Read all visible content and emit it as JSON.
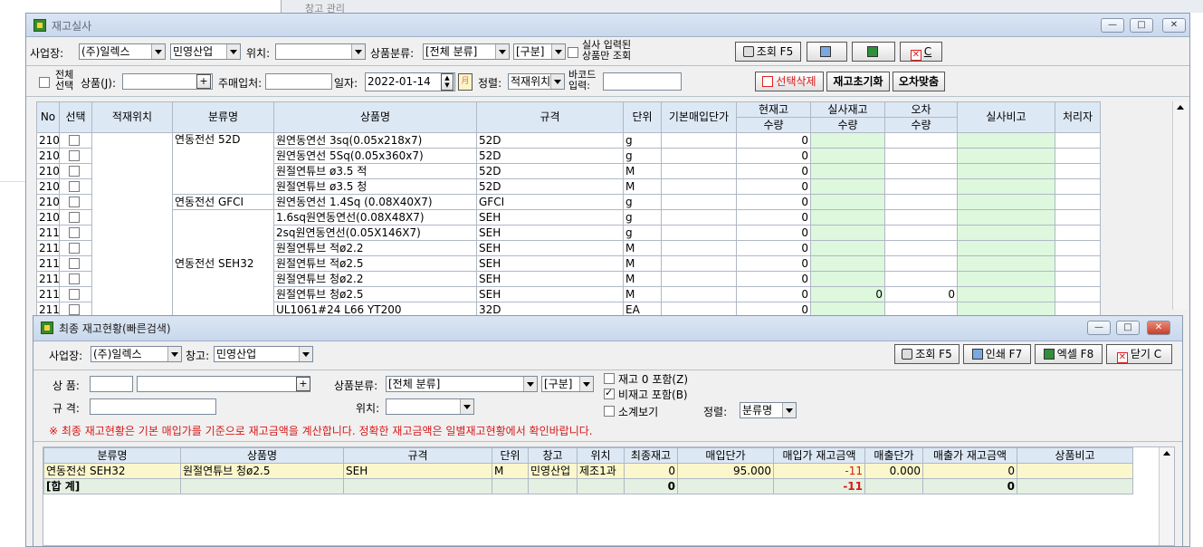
{
  "bg_window": {
    "title": "창고 관리"
  },
  "main_window": {
    "title": "재고실사",
    "toolbar1": {
      "business_label": "사업장:",
      "business_value": "(주)일렉스",
      "warehouse_value": "민영산업",
      "location_label": "위치:",
      "location_value": "",
      "category_label": "상품분류:",
      "category_value": "[전체 분류]",
      "division_value": "[구분]",
      "only_counted_label_1": "실사 입력된",
      "only_counted_label_2": "상품만 조회",
      "search_btn": "조회 F5",
      "close_btn": "C"
    },
    "toolbar2": {
      "select_all_1": "전체",
      "select_all_2": "선택",
      "product_label": "상품(J):",
      "product_value": "",
      "buyer_label": "주매입처:",
      "buyer_value": "",
      "date_label": "일자:",
      "date_value": "2022-01-14",
      "sort_label": "정렬:",
      "sort_value": "적재위치",
      "barcode_label_1": "바코드",
      "barcode_label_2": "입력:",
      "barcode_value": "",
      "delete_selected_btn": "선택삭제",
      "reset_stock_btn": "재고초기화",
      "match_error_btn": "오차맞춤"
    },
    "grid": {
      "headers": {
        "no": "No",
        "sel": "선택",
        "loc": "적재위치",
        "cat": "분류명",
        "name": "상품명",
        "spec": "규격",
        "unit": "단위",
        "price": "기본매입단가",
        "cur_top": "현재고",
        "cur_bot": "수량",
        "real_top": "실사재고",
        "real_bot": "수량",
        "err_top": "오차",
        "err_bot": "수량",
        "note": "실사비고",
        "handler": "처리자"
      },
      "rows": [
        {
          "no": "210",
          "cat": "연동전선 52D",
          "name": "원연동연선 3sq(0.05x218x7)",
          "spec": "52D",
          "unit": "g",
          "cur": "0",
          "real": "",
          "err": ""
        },
        {
          "no": "210",
          "cat": "",
          "name": "원연동연선 5Sq(0.05x360x7)",
          "spec": "52D",
          "unit": "g",
          "cur": "0",
          "real": "",
          "err": ""
        },
        {
          "no": "210",
          "cat": "",
          "name": "원절연튜브 ø3.5 적",
          "spec": "52D",
          "unit": "M",
          "cur": "0",
          "real": "",
          "err": ""
        },
        {
          "no": "210",
          "cat": "",
          "name": "원절연튜브 ø3.5 청",
          "spec": "52D",
          "unit": "M",
          "cur": "0",
          "real": "",
          "err": ""
        },
        {
          "no": "210",
          "cat": "연동전선 GFCI",
          "name": "원연동연선 1.4Sq (0.08X40X7)",
          "spec": "GFCI",
          "unit": "g",
          "cur": "0",
          "real": "",
          "err": ""
        },
        {
          "no": "210",
          "cat": "",
          "name": "1.6sq원연동연선(0.08X48X7)",
          "spec": "SEH",
          "unit": "g",
          "cur": "0",
          "real": "",
          "err": ""
        },
        {
          "no": "211",
          "cat": "",
          "name": "2sq원연동연선(0.05X146X7)",
          "spec": "SEH",
          "unit": "g",
          "cur": "0",
          "real": "",
          "err": ""
        },
        {
          "no": "211",
          "cat": "연동전선 SEH32",
          "name": "원절연튜브 적ø2.2",
          "spec": "SEH",
          "unit": "M",
          "cur": "0",
          "real": "",
          "err": ""
        },
        {
          "no": "211",
          "cat": "",
          "name": "원절연튜브 적ø2.5",
          "spec": "SEH",
          "unit": "M",
          "cur": "0",
          "real": "",
          "err": ""
        },
        {
          "no": "211",
          "cat": "",
          "name": "원절연튜브 청ø2.2",
          "spec": "SEH",
          "unit": "M",
          "cur": "0",
          "real": "",
          "err": ""
        },
        {
          "no": "211",
          "cat": "",
          "name": "원절연튜브 청ø2.5",
          "spec": "SEH",
          "unit": "M",
          "cur": "0",
          "real": "0",
          "err": "0"
        },
        {
          "no": "211",
          "cat": "",
          "name": "UL1061#24 L66 YT200",
          "spec": "32D",
          "unit": "EA",
          "cur": "0",
          "real": "",
          "err": ""
        }
      ]
    }
  },
  "popup": {
    "title": "최종 재고현황(빠른검색)",
    "business_label": "사업장:",
    "business_value": "(주)일렉스",
    "warehouse_label": "창고:",
    "warehouse_value": "민영산업",
    "search_btn": "조회 F5",
    "print_btn": "인쇄 F7",
    "excel_btn": "엑셀 F8",
    "close_btn": "닫기 C",
    "product_label": "상 품:",
    "product_code": "",
    "product_name": "",
    "category_label": "상품분류:",
    "category_value": "[전체 분류]",
    "division_value": "[구분]",
    "spec_label": "규 격:",
    "spec_value": "",
    "location_label": "위치:",
    "location_value": "",
    "include_zero_label": "재고 0 포함(Z)",
    "include_nonstock_label": "비재고 포함(B)",
    "subtotal_label": "소계보기",
    "sort_label": "정렬:",
    "sort_value": "분류명",
    "notice": "※ 최종 재고현황은 기본 매입가를 기준으로 재고금액을 계산합니다. 정확한 재고금액은 일별재고현황에서 확인바랍니다.",
    "grid": {
      "headers": [
        "분류명",
        "상품명",
        "규격",
        "단위",
        "창고",
        "위치",
        "최종재고",
        "매입단가",
        "매입가 재고금액",
        "매출단가",
        "매출가 재고금액",
        "상품비고"
      ],
      "row": [
        "연동전선 SEH32",
        "원절연튜브 청ø2.5",
        "SEH",
        "M",
        "민영산업",
        "제조1과",
        "0",
        "95.000",
        "-11",
        "0.000",
        "0",
        ""
      ],
      "total": [
        "[합 계]",
        "",
        "",
        "",
        "",
        "",
        "0",
        "",
        "-11",
        "",
        "0",
        ""
      ]
    }
  },
  "colors": {
    "negative": "#d81818",
    "real_col_bg": "#ddf8dd",
    "selected_row_bg": "#fbf7cc",
    "total_row_bg": "#e4f0e2"
  }
}
